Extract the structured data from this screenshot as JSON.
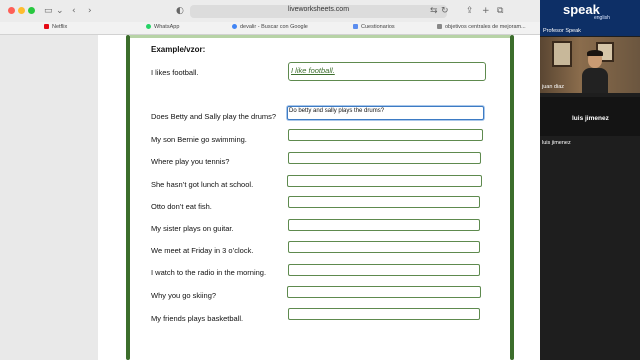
{
  "browser": {
    "url": "liveworksheets.com",
    "bookmarks": [
      {
        "label": "Netflix",
        "color": "#e50914"
      },
      {
        "label": "WhatsApp",
        "color": "#25d366"
      },
      {
        "label": "devalir - Buscar con Google",
        "color": "#4285f4"
      },
      {
        "label": "Cuestionarios",
        "color": "#5b8def"
      },
      {
        "label": "objetivos centrales de mejoram...",
        "color": "#888888"
      }
    ]
  },
  "worksheet": {
    "heading": "Example/vzor:",
    "example": {
      "sentence": "I likes football.",
      "answer": "I like football."
    },
    "questions": [
      {
        "sentence": "Does Betty and Sally play the drums?",
        "answer": "Do betty and sally plays  the drums?"
      },
      {
        "sentence": "My son Bernie go swimming.",
        "answer": ""
      },
      {
        "sentence": "Where play you tennis?",
        "answer": ""
      },
      {
        "sentence": "She hasn’t got lunch at school.",
        "answer": ""
      },
      {
        "sentence": "Otto don’t eat fish.",
        "answer": ""
      },
      {
        "sentence": "My sister plays on guitar.",
        "answer": ""
      },
      {
        "sentence": "We meet at Friday in 3 o’clock.",
        "answer": ""
      },
      {
        "sentence": "I watch to the radio in the morning.",
        "answer": ""
      },
      {
        "sentence": "Why you go skiing?",
        "answer": ""
      },
      {
        "sentence": "My friends plays basketball.",
        "answer": ""
      }
    ]
  },
  "video": {
    "logo": "speak",
    "logo_sub": "english",
    "top_tile_name": "Profesor Speak",
    "video_tile_name": "juan diaz",
    "mid_tile_name": "luis jimenez",
    "bottom_tile_name": "luis jimenez"
  }
}
